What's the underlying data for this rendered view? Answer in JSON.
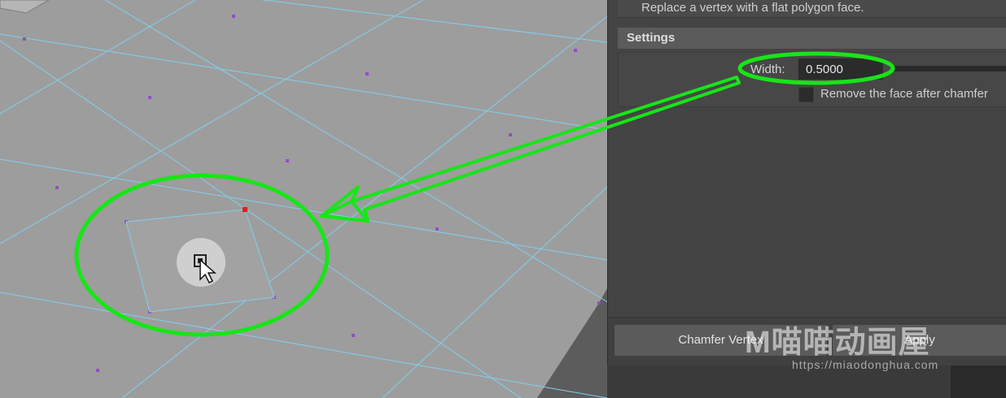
{
  "tool_panel": {
    "description": "Replace a vertex with a flat polygon face.",
    "settings_header": "Settings",
    "width_label": "Width:",
    "width_value": "0.5000",
    "remove_face_label": "Remove the face after chamfer",
    "remove_face_checked": false,
    "chamfer_button": "Chamfer Vertex",
    "apply_button": "Apply"
  },
  "watermark": {
    "logo_text": "M喵喵动画屋",
    "url": "https://miaodonghua.com"
  },
  "colors": {
    "annotation_green": "#17e617",
    "viewport_plane": "#9d9d9d",
    "wireframe": "#7fd0f0",
    "vertex": "#8e4fc0",
    "selected_vertex": "#e0201a"
  }
}
